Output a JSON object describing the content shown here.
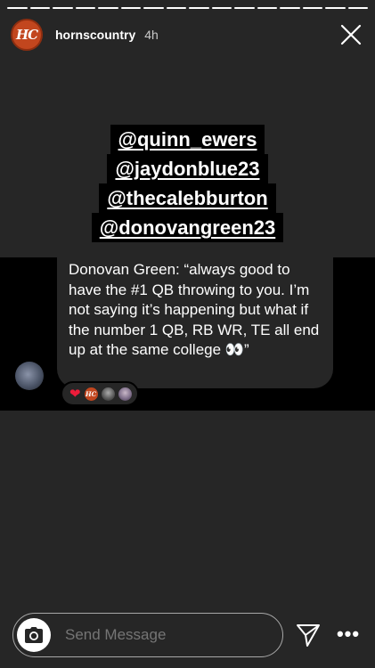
{
  "story": {
    "segments_total": 16,
    "segments_viewed": 16,
    "account": {
      "username": "hornscountry",
      "avatar_initials": "HC",
      "posted_ago": "4h"
    },
    "mentions": [
      "@quinn_ewers",
      "@jaydonblue23",
      "@thecalebburton",
      "@donovangreen23"
    ],
    "dm_message": "Donovan Green: “always good to have the #1 QB throwing to you. I’m not saying it’s happening but what if the number 1 QB, RB WR, TE all end up at the same college 👀”",
    "dm_reactions": {
      "emoji": "❤️",
      "avatars": [
        "HC"
      ]
    }
  },
  "footer": {
    "reply_placeholder": "Send Message",
    "more_label": "•••"
  },
  "colors": {
    "background": "#262626",
    "brand": "#c2461e",
    "heart": "#ed1c3a"
  }
}
